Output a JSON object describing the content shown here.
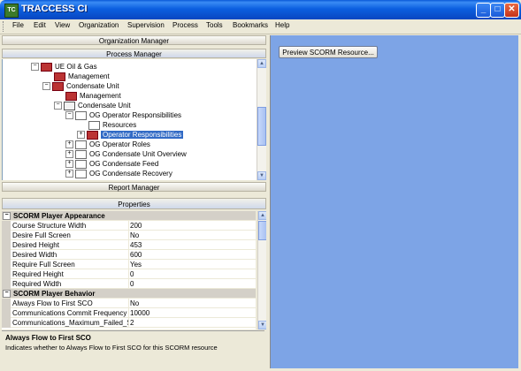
{
  "window": {
    "title": "TRACCESS CI",
    "icon": "app-icon",
    "controls": [
      "_",
      "□",
      "✕"
    ]
  },
  "menu": [
    "File",
    "Edit",
    "View",
    "Organization",
    "Supervision",
    "Process",
    "Tools",
    "Bookmarks",
    "Help"
  ],
  "accordion": {
    "organization_manager": "Organization Manager",
    "process_manager": "Process Manager",
    "report_manager": "Report Manager",
    "properties": "Properties"
  },
  "tree": [
    {
      "label": "UE Oil & Gas",
      "toggle": "−",
      "icon": "flag-icon"
    },
    {
      "label": "Management",
      "toggle": "",
      "icon": "people-icon"
    },
    {
      "label": "Condensate Unit",
      "toggle": "−",
      "icon": "flag-icon"
    },
    {
      "label": "Management",
      "toggle": "",
      "icon": "people-icon"
    },
    {
      "label": "Condensate Unit",
      "toggle": "−",
      "icon": "unit-icon"
    },
    {
      "label": "OG  Operator Responsibilities",
      "toggle": "−",
      "icon": "course-icon"
    },
    {
      "label": "Resources",
      "toggle": "",
      "icon": "resources-icon"
    },
    {
      "label": "Operator Responsibilities",
      "toggle": "+",
      "icon": "scorm-icon",
      "selected": true
    },
    {
      "label": "OG  Operator Roles",
      "toggle": "+",
      "icon": "course-icon"
    },
    {
      "label": "OG  Condensate Unit Overview",
      "toggle": "+",
      "icon": "course-icon"
    },
    {
      "label": "OG  Condensate Feed",
      "toggle": "+",
      "icon": "course-icon"
    },
    {
      "label": "OG  Condensate Recovery",
      "toggle": "+",
      "icon": "course-icon"
    }
  ],
  "properties": [
    {
      "category": "SCORM Player Appearance",
      "toggle": "−"
    },
    {
      "name": "Course Structure Width",
      "value": "200"
    },
    {
      "name": "Desire Full Screen",
      "value": "No"
    },
    {
      "name": "Desired Height",
      "value": "453"
    },
    {
      "name": "Desired Width",
      "value": "600"
    },
    {
      "name": "Require Full Screen",
      "value": "Yes"
    },
    {
      "name": "Required Height",
      "value": "0"
    },
    {
      "name": "Required Width",
      "value": "0"
    },
    {
      "category": "SCORM Player Behavior",
      "toggle": "−"
    },
    {
      "name": "Always Flow to First SCO",
      "value": "No"
    },
    {
      "name": "Communications Commit Frequency",
      "value": "10000"
    },
    {
      "name": "Communications_Maximum_Failed_Sui",
      "value": "2"
    }
  ],
  "description": {
    "title": "Always Flow to First SCO",
    "text": "Indicates whether to Always Flow to First SCO for this SCORM resource"
  },
  "preview_button": "Preview SCORM Resource...",
  "colors": {
    "title_bar": "#0b5fe0",
    "selection": "#316ac5",
    "workspace": "#7da4e6"
  }
}
